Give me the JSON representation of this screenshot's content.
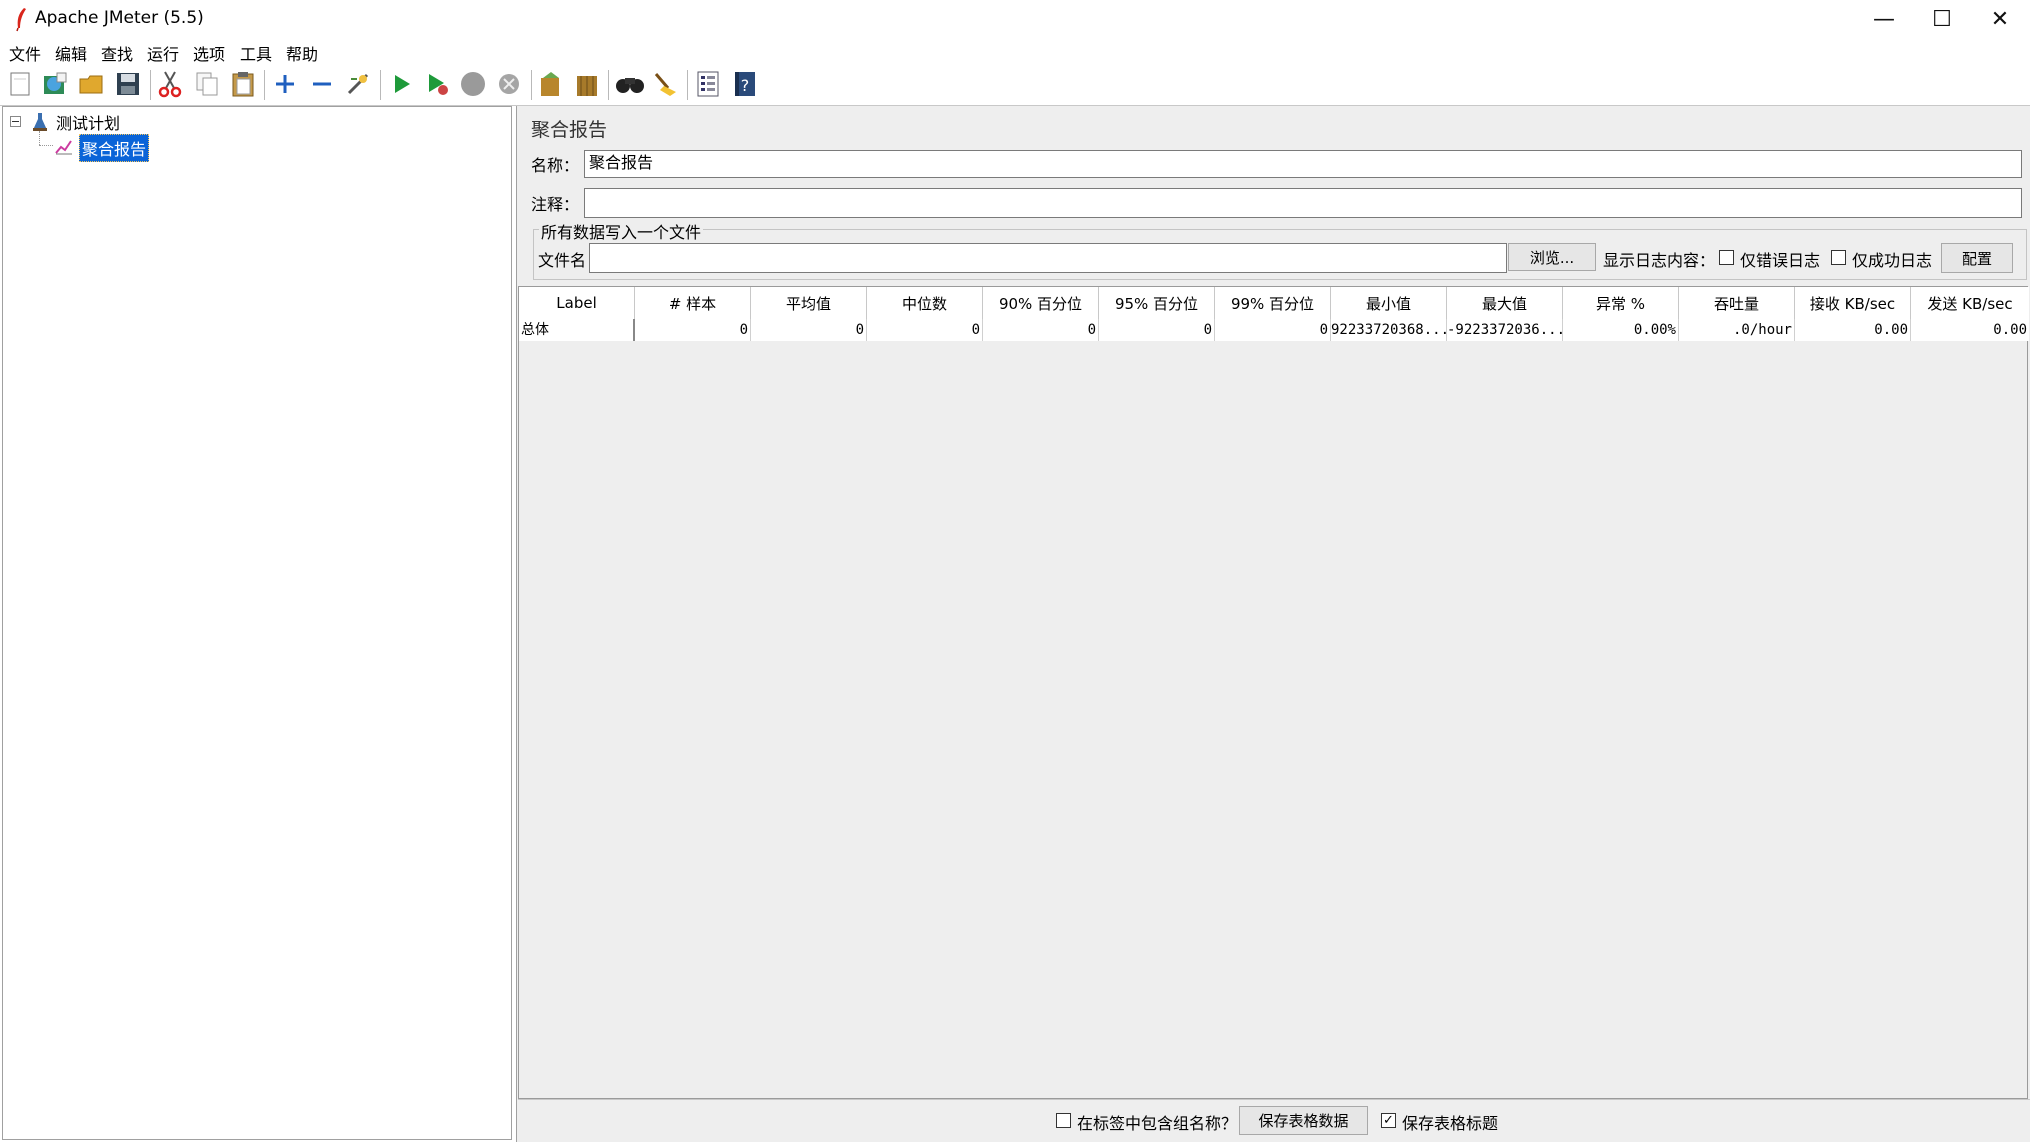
{
  "window": {
    "title": "Apache JMeter (5.5)",
    "minimize": "—",
    "maximize": "☐",
    "close": "✕"
  },
  "menu": [
    "文件",
    "编辑",
    "查找",
    "运行",
    "选项",
    "工具",
    "帮助"
  ],
  "toolbar_icons": [
    "new-icon",
    "templates-icon",
    "open-icon",
    "save-icon",
    "cut-icon",
    "copy-icon",
    "paste-icon",
    "expand-icon",
    "collapse-icon",
    "toggle-icon",
    "start-icon",
    "start-no-pause-icon",
    "stop-icon",
    "shutdown-icon",
    "clear-icon",
    "clear-all-icon",
    "search-icon",
    "reset-search-icon",
    "function-helper-icon",
    "help-icon"
  ],
  "tree": {
    "root": "测试计划",
    "child": "聚合报告"
  },
  "panel": {
    "title": "聚合报告",
    "name_label": "名称：",
    "name_value": "聚合报告",
    "comment_label": "注释：",
    "comment_value": "",
    "file_group_title": "所有数据写入一个文件",
    "filename_label": "文件名",
    "filename_value": "",
    "browse_button": "浏览...",
    "log_display_label": "显示日志内容：",
    "errors_only_label": "仅错误日志",
    "success_only_label": "仅成功日志",
    "configure_button": "配置"
  },
  "table": {
    "headers": [
      "Label",
      "# 样本",
      "平均值",
      "中位数",
      "90% 百分位",
      "95% 百分位",
      "99% 百分位",
      "最小值",
      "最大值",
      "异常 %",
      "吞吐量",
      "接收 KB/sec",
      "发送 KB/sec"
    ],
    "rows": [
      [
        "总体",
        "0",
        "0",
        "0",
        "0",
        "0",
        "0",
        "92233720368...",
        "-9223372036...",
        "0.00%",
        ".0/hour",
        "0.00",
        "0.00"
      ]
    ]
  },
  "bottom": {
    "include_group_name_label": "在标签中包含组名称？",
    "include_group_name_checked": false,
    "save_table_data_button": "保存表格数据",
    "save_table_header_label": "保存表格标题",
    "save_table_header_checked": true
  },
  "colors": {
    "selection": "#0a64d8",
    "panel_bg": "#eeeeee"
  }
}
